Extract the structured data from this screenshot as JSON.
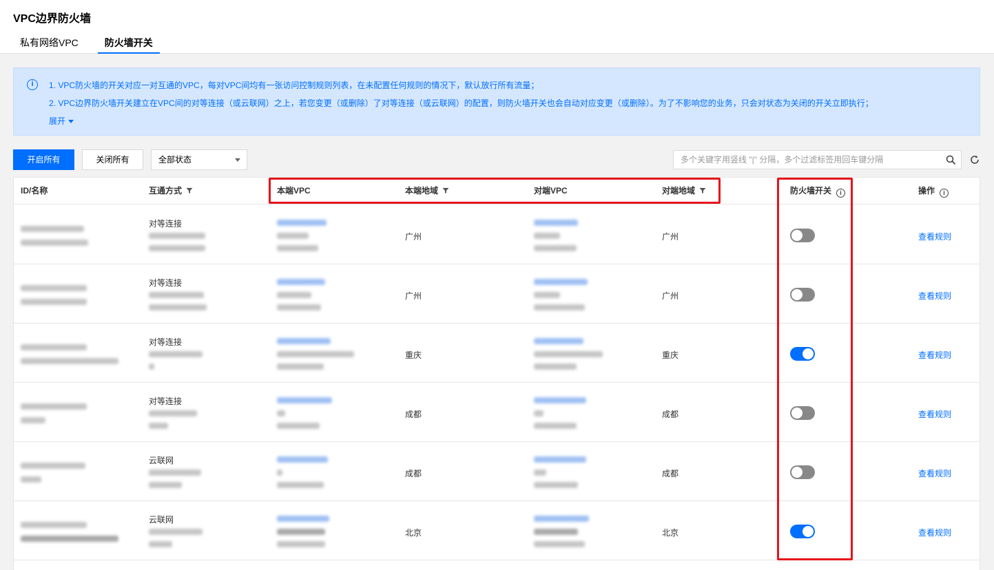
{
  "page_title": "VPC边界防火墙",
  "tabs": [
    {
      "label": "私有网络VPC"
    },
    {
      "label": "防火墙开关",
      "active": true
    }
  ],
  "notice": {
    "icon": "info-icon",
    "line1": "1. VPC防火墙的开关对应一对互通的VPC，每对VPC间均有一张访问控制规则列表，在未配置任何规则的情况下，默认放行所有流量；",
    "line2": "2. VPC边界防火墙开关建立在VPC间的对等连接（或云联网）之上，若您变更（或删除）了对等连接（或云联网）的配置，则防火墙开关也会自动对应变更（或删除）。为了不影响您的业务，只会对状态为关闭的开关立即执行；",
    "expand_label": "展开"
  },
  "toolbar": {
    "enable_all_label": "开启所有",
    "disable_all_label": "关闭所有",
    "status_select_value": "全部状态",
    "search_placeholder": "多个关键字用竖线 \"|\" 分隔，多个过滤标签用回车键分隔"
  },
  "table": {
    "columns": {
      "id_name": "ID/名称",
      "connect_type": "互通方式",
      "local_vpc": "本端VPC",
      "local_region": "本端地域",
      "peer_vpc": "对端VPC",
      "peer_region": "对端地域",
      "fw_switch": "防火墙开关",
      "action": "操作"
    },
    "rows": [
      {
        "connect_type": "对等连接",
        "local_region": "广州",
        "peer_region": "广州",
        "fw_on": false,
        "action": "查看规则"
      },
      {
        "connect_type": "对等连接",
        "local_region": "广州",
        "peer_region": "广州",
        "fw_on": false,
        "action": "查看规则"
      },
      {
        "connect_type": "对等连接",
        "local_region": "重庆",
        "peer_region": "重庆",
        "fw_on": true,
        "action": "查看规则"
      },
      {
        "connect_type": "对等连接",
        "local_region": "成都",
        "peer_region": "成都",
        "fw_on": false,
        "action": "查看规则"
      },
      {
        "connect_type": "云联网",
        "local_region": "成都",
        "peer_region": "成都",
        "fw_on": false,
        "action": "查看规则"
      },
      {
        "connect_type": "云联网",
        "local_region": "北京",
        "peer_region": "北京",
        "fw_on": true,
        "action": "查看规则"
      }
    ]
  },
  "colors": {
    "accent": "#006eff",
    "toggle_off": "#888888",
    "highlight": "#e5141b",
    "notice_bg": "#d5e7ff"
  }
}
